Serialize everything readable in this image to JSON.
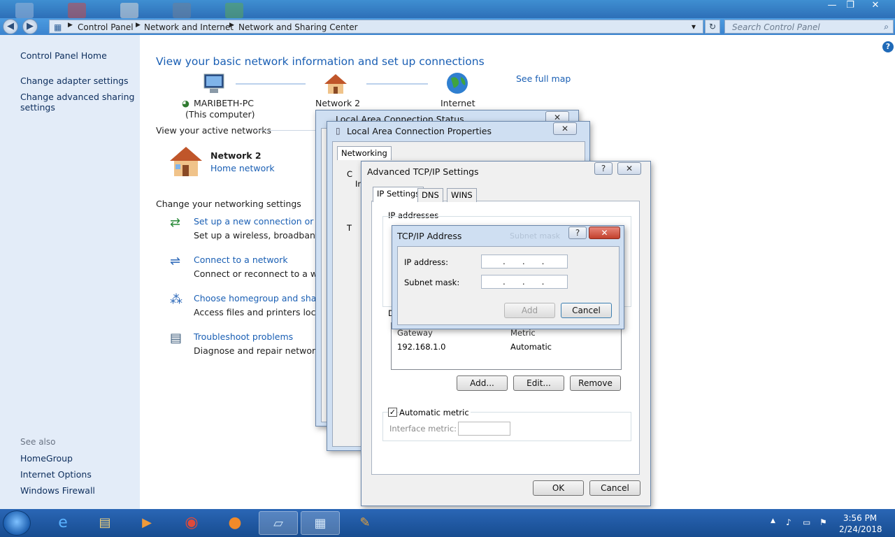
{
  "window": {
    "minimize": "—",
    "maximize": "❐",
    "close": "✕",
    "back": "◀",
    "forward": "▶",
    "breadcrumb": [
      "Control Panel",
      "Network and Internet",
      "Network and Sharing Center"
    ],
    "search_placeholder": "Search Control Panel",
    "refresh": "↻",
    "dropdown": "▾"
  },
  "sidebar": {
    "home": "Control Panel Home",
    "adapter": "Change adapter settings",
    "advanced_line1": "Change advanced sharing",
    "advanced_line2": "settings",
    "see_also": "See also",
    "homegroup": "HomeGroup",
    "internet_options": "Internet Options",
    "firewall": "Windows Firewall"
  },
  "main": {
    "heading": "View your basic network information and set up connections",
    "see_full_map": "See full map",
    "computer_name": "MARIBETH-PC",
    "this_computer": "(This computer)",
    "network_node": "Network  2",
    "internet_node": "Internet",
    "active_networks": "View your active networks",
    "network_name": "Network  2",
    "network_type": "Home network",
    "change_settings": "Change your networking settings",
    "tasks": [
      {
        "link": "Set up a new connection or netw",
        "desc": "Set up a wireless, broadband, dial"
      },
      {
        "link": "Connect to a network",
        "desc": "Connect or reconnect to a wirele"
      },
      {
        "link": "Choose homegroup and sharing",
        "desc": "Access files and printers located o"
      },
      {
        "link": "Troubleshoot problems",
        "desc": "Diagnose and repair network prol"
      }
    ],
    "help": "?"
  },
  "lac_status": {
    "title": "Local Area Connection Status"
  },
  "lac_props": {
    "title": "Local Area Connection Properties",
    "tab": "Networking",
    "partial_c": "C",
    "partial_t": "T",
    "partial_i": "In"
  },
  "adv_tcpip": {
    "title": "Advanced TCP/IP Settings",
    "tabs": [
      "IP Settings",
      "DNS",
      "WINS"
    ],
    "ip_addresses": "IP addresses",
    "default_gw_prefix": "D",
    "gateway_header": "Gateway",
    "metric_header": "Metric",
    "gateway_value": "192.168.1.0",
    "metric_value": "Automatic",
    "add_btn": "Add...",
    "edit_btn": "Edit...",
    "remove_btn": "Remove",
    "auto_metric": "Automatic metric",
    "interface_metric": "Interface metric:",
    "ok": "OK",
    "cancel": "Cancel",
    "checkmark": "✓"
  },
  "tcpip_addr": {
    "title": "TCP/IP Address",
    "ip_label": "IP address:",
    "ip_value": "...",
    "mask_label": "Subnet mask:",
    "mask_value": "...",
    "add": "Add",
    "cancel": "Cancel",
    "faint": "Subnet mask"
  },
  "taskbar": {
    "time": "3:56 PM",
    "date": "2/24/2018"
  }
}
